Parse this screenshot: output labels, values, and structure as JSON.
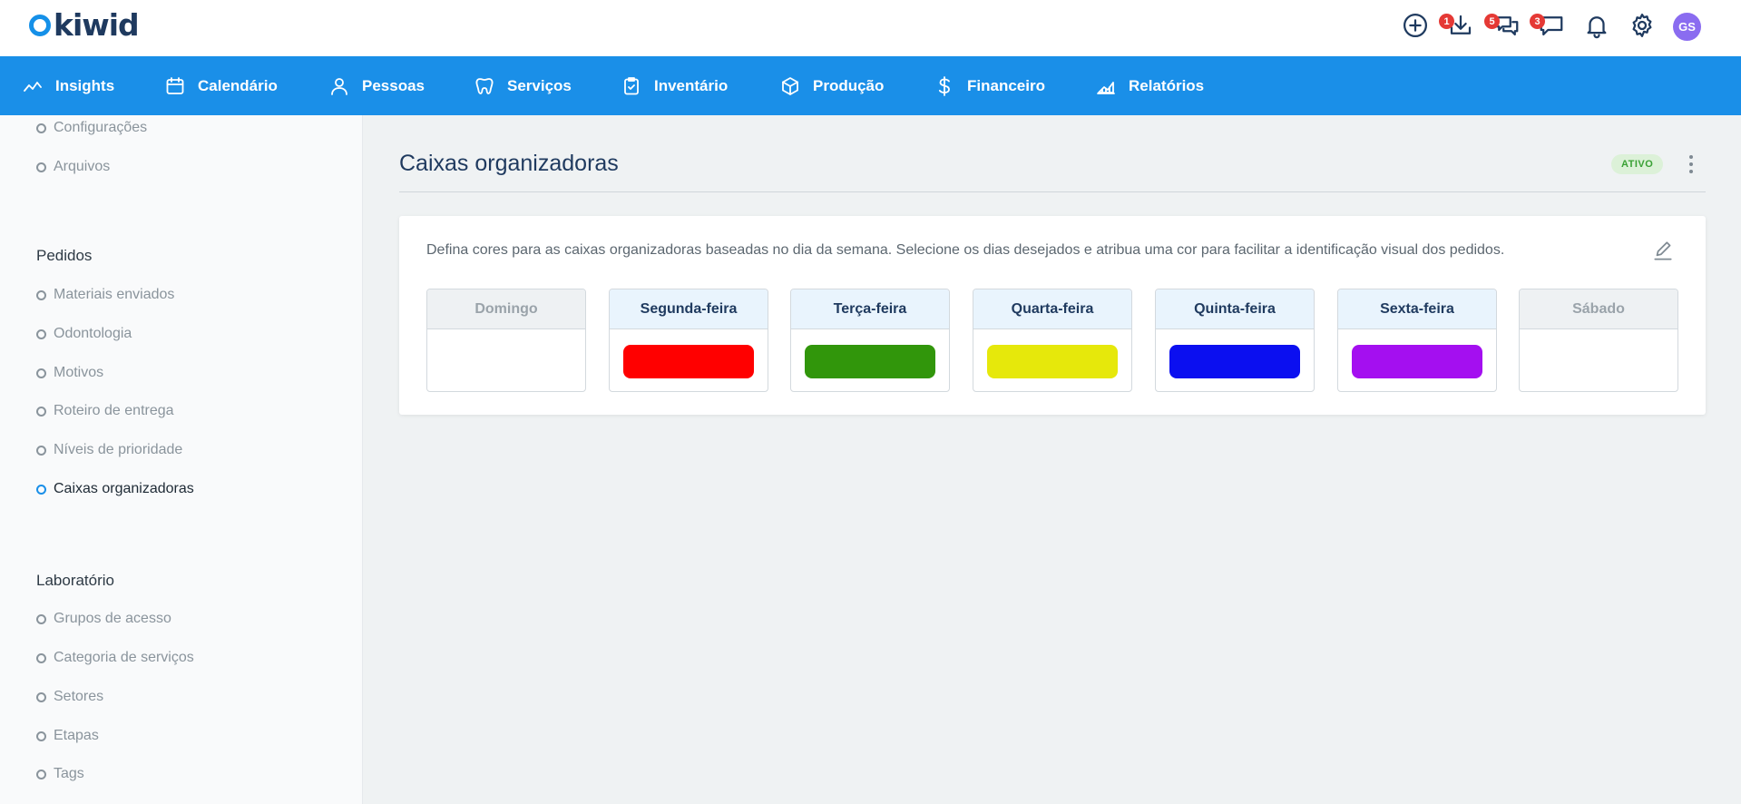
{
  "app": {
    "logo_text": "kiwid"
  },
  "topbar": {
    "icons": [
      {
        "name": "add-circle-icon",
        "badge": null
      },
      {
        "name": "download-icon",
        "badge": "1"
      },
      {
        "name": "chat-bubbles-icon",
        "badge": "5"
      },
      {
        "name": "message-icon",
        "badge": "3"
      },
      {
        "name": "bell-icon",
        "badge": null
      },
      {
        "name": "gear-icon",
        "badge": null
      }
    ],
    "avatar_initials": "GS",
    "avatar_color": "#8a6cf0"
  },
  "nav": {
    "items": [
      {
        "label": "Insights",
        "icon": "trend-line-icon"
      },
      {
        "label": "Calendário",
        "icon": "calendar-icon"
      },
      {
        "label": "Pessoas",
        "icon": "person-icon"
      },
      {
        "label": "Serviços",
        "icon": "tooth-icon"
      },
      {
        "label": "Inventário",
        "icon": "clipboard-icon"
      },
      {
        "label": "Produção",
        "icon": "box-icon"
      },
      {
        "label": "Financeiro",
        "icon": "dollar-icon"
      },
      {
        "label": "Relatórios",
        "icon": "chart-area-icon"
      }
    ],
    "color": "#1a8fe8"
  },
  "sidebar": {
    "top_items": [
      "Configurações",
      "Arquivos"
    ],
    "groups": [
      {
        "title": "Pedidos",
        "items": [
          "Materiais enviados",
          "Odontologia",
          "Motivos",
          "Roteiro de entrega",
          "Níveis de prioridade",
          "Caixas organizadoras"
        ]
      },
      {
        "title": "Laboratório",
        "items": [
          "Grupos de acesso",
          "Categoria de serviços",
          "Setores",
          "Etapas",
          "Tags"
        ]
      }
    ],
    "active_item": "Caixas organizadoras"
  },
  "main": {
    "title": "Caixas organizadoras",
    "status": "ATIVO",
    "description": "Defina cores para as caixas organizadoras baseadas no dia da semana. Selecione os dias desejados e atribua uma cor para facilitar a identificação visual dos pedidos.",
    "days": [
      {
        "label": "Domingo",
        "enabled": false,
        "color": null
      },
      {
        "label": "Segunda-feira",
        "enabled": true,
        "color": "#ff0000"
      },
      {
        "label": "Terça-feira",
        "enabled": true,
        "color": "#31960b"
      },
      {
        "label": "Quarta-feira",
        "enabled": true,
        "color": "#e6e80b"
      },
      {
        "label": "Quinta-feira",
        "enabled": true,
        "color": "#0b0ff0"
      },
      {
        "label": "Sexta-feira",
        "enabled": true,
        "color": "#a40ff0"
      },
      {
        "label": "Sábado",
        "enabled": false,
        "color": null
      }
    ]
  }
}
